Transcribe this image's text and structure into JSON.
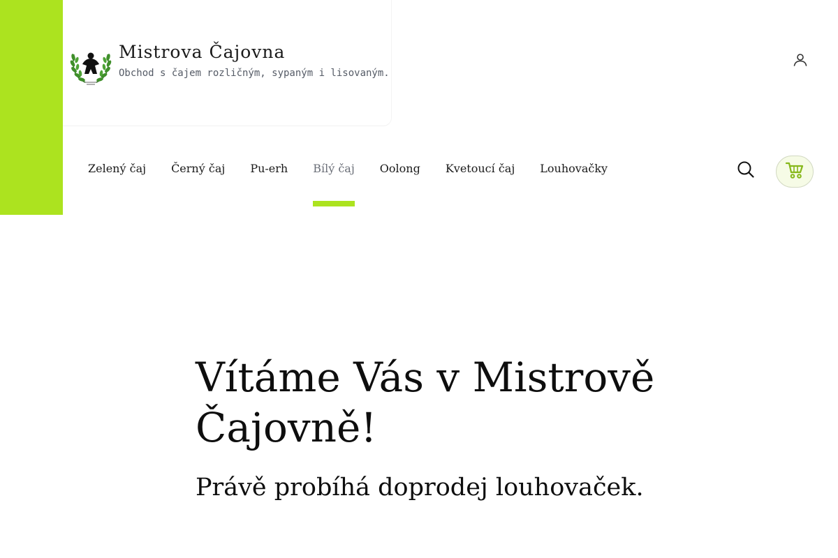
{
  "brand": {
    "title": "Mistrova Čajovna",
    "tagline": "Obchod s čajem rozličným, sypaným i lisovaným.",
    "accent_color": "#ace31f",
    "logo_icon": "meeple-laurel-logo"
  },
  "header": {
    "account_icon": "user-icon",
    "search_icon": "search-icon",
    "cart_icon": "cart-icon"
  },
  "nav": {
    "items": [
      {
        "label": "Zelený čaj",
        "active": false
      },
      {
        "label": "Černý čaj",
        "active": false
      },
      {
        "label": "Pu-erh",
        "active": false
      },
      {
        "label": "Bílý čaj",
        "active": true
      },
      {
        "label": "Oolong",
        "active": false
      },
      {
        "label": "Kvetoucí čaj",
        "active": false
      },
      {
        "label": "Louhovačky",
        "active": false
      }
    ]
  },
  "hero": {
    "heading": "Vítáme Vás v Mistrově Čajovně!",
    "subheading": "Právě probíhá doprodej louhovaček."
  }
}
